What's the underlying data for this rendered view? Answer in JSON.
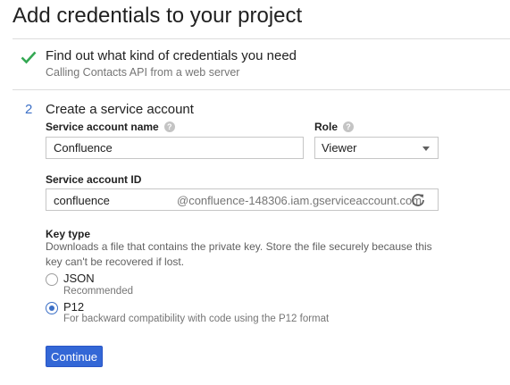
{
  "page": {
    "title": "Add credentials to your project"
  },
  "step1": {
    "title": "Find out what kind of credentials you need",
    "subtitle": "Calling Contacts API from a web server",
    "icon": "check-icon",
    "color": "#34a853"
  },
  "step2": {
    "number": "2",
    "title": "Create a service account",
    "account_name": {
      "label": "Service account name",
      "value": "Confluence",
      "help_icon": "help-icon"
    },
    "role": {
      "label": "Role",
      "value": "Viewer",
      "help_icon": "help-icon"
    },
    "account_id": {
      "label": "Service account ID",
      "value": "confluence",
      "suffix": "@confluence-148306.iam.gserviceaccount.com",
      "icon": "refresh-icon"
    },
    "key_type": {
      "label": "Key type",
      "description": "Downloads a file that contains the private key. Store the file securely because this key can't be recovered if lost.",
      "options": [
        {
          "label": "JSON",
          "description": "Recommended",
          "selected": false
        },
        {
          "label": "P12",
          "description": "For backward compatibility with code using the P12 format",
          "selected": true
        }
      ]
    },
    "continue_label": "Continue"
  },
  "colors": {
    "accent": "#3367d6",
    "check": "#34a853"
  }
}
